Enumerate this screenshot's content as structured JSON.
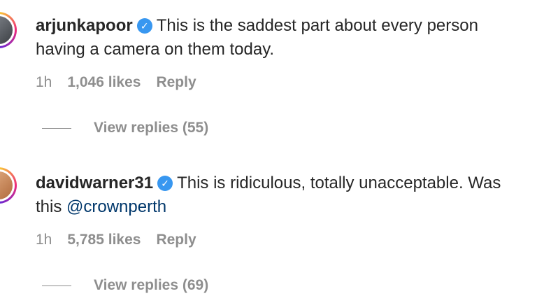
{
  "comments": [
    {
      "username": "arjunkapoor",
      "text": "This is the saddest part about every person having a camera on them today.",
      "mention": "",
      "time": "1h",
      "likes": "1,046 likes",
      "reply_label": "Reply",
      "view_replies": "View replies (55)"
    },
    {
      "username": "davidwarner31",
      "text": "This is ridiculous, totally unacceptable. Was this ",
      "mention": "@crownperth",
      "time": "1h",
      "likes": "5,785 likes",
      "reply_label": "Reply",
      "view_replies": "View replies (69)"
    }
  ],
  "icons": {
    "verified": "verified-badge-icon"
  },
  "colors": {
    "verified": "#3897f0",
    "mention": "#00376b",
    "meta": "#8e8e8e",
    "text": "#262626"
  }
}
